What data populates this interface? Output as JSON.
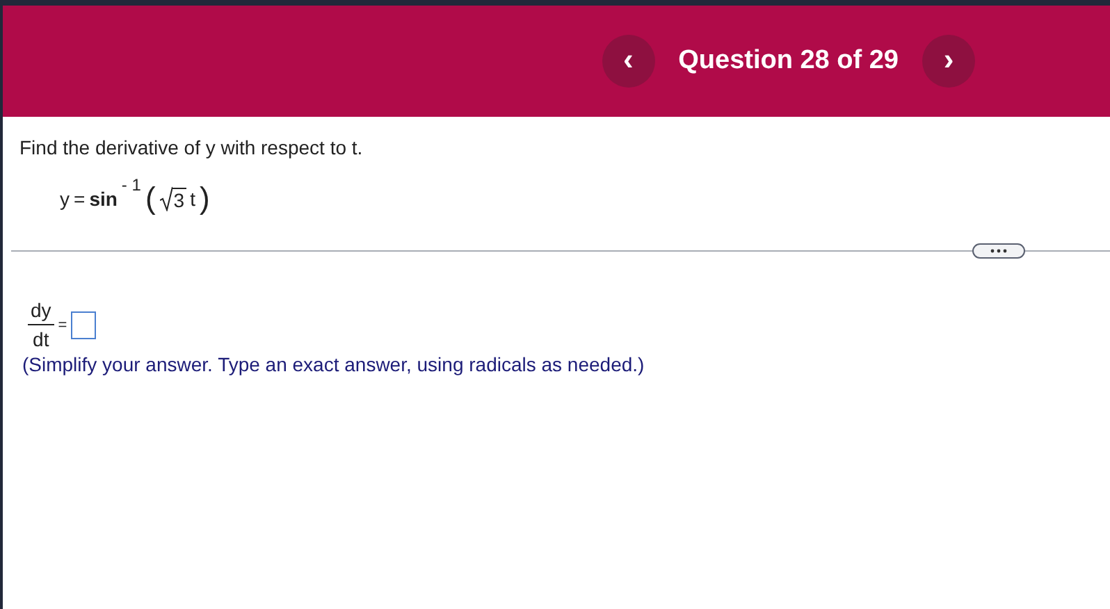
{
  "header": {
    "prev_button": "‹",
    "title": "Question 28 of 29",
    "next_button": "›"
  },
  "question": {
    "prompt": "Find the derivative of y with respect to t.",
    "equation": {
      "lhs": "y",
      "eq": "=",
      "func": "sin",
      "exponent": "- 1",
      "open": "(",
      "radicand": "3",
      "variable": "t",
      "close": ")"
    }
  },
  "answer": {
    "numerator": "dy",
    "denominator": "dt",
    "eq": "=",
    "instruction": "(Simplify your answer. Type an exact answer, using radicals as needed.)"
  }
}
